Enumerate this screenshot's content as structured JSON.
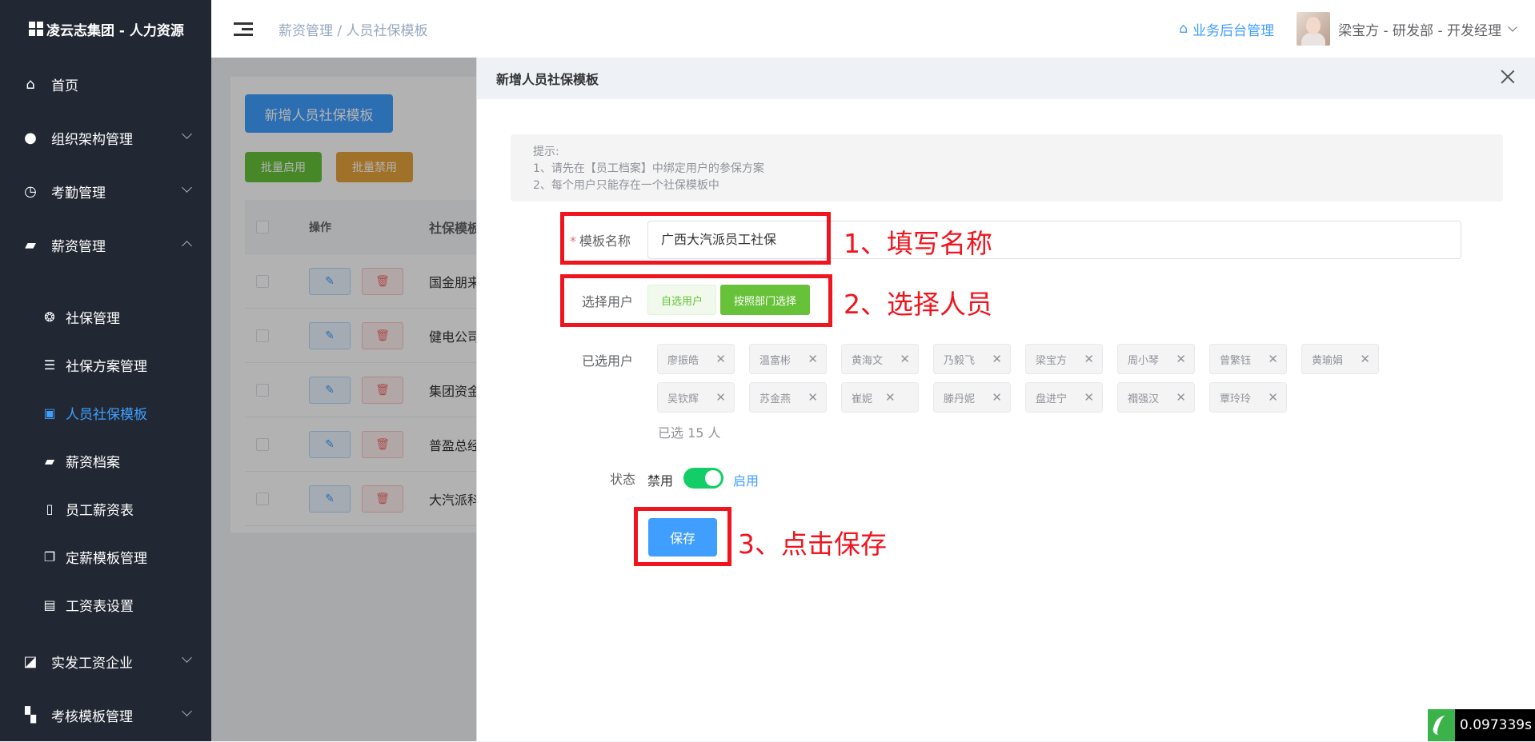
{
  "sidebar": {
    "logo_text": "凌云志集团 - 人力资源",
    "menu": [
      {
        "label": "首页",
        "icon": "home-icon"
      },
      {
        "label": "组织架构管理",
        "icon": "user-icon"
      },
      {
        "label": "考勤管理",
        "icon": "clock-icon"
      },
      {
        "label": "薪资管理",
        "icon": "wallet-icon"
      }
    ],
    "sub_items": [
      {
        "label": "社保管理",
        "icon": "shield-icon"
      },
      {
        "label": "社保方案管理",
        "icon": "sliders-icon"
      },
      {
        "label": "人员社保模板",
        "icon": "briefcase-icon"
      },
      {
        "label": "薪资档案",
        "icon": "wallet-icon"
      },
      {
        "label": "员工薪资表",
        "icon": "book-icon"
      },
      {
        "label": "定薪模板管理",
        "icon": "copy-icon"
      },
      {
        "label": "工资表设置",
        "icon": "list-icon"
      }
    ],
    "bottom_menu": [
      {
        "label": "实发工资企业",
        "icon": "chart-icon"
      },
      {
        "label": "考核模板管理",
        "icon": "bookmarks-icon"
      }
    ]
  },
  "header": {
    "breadcrumb_parent": "薪资管理",
    "breadcrumb_sep": "/",
    "breadcrumb_current": "人员社保模板",
    "backend_link": "业务后台管理",
    "user": "梁宝方 - 研发部 - 开发经理"
  },
  "page": {
    "add_button": "新增人员社保模板",
    "batch_enable": "批量启用",
    "batch_disable": "批量禁用",
    "table_headers": {
      "op": "操作",
      "name": "社保模板"
    },
    "rows": [
      "国金朋来",
      "健电公司",
      "集团资金",
      "普盈总经",
      "大汽派科"
    ],
    "edit_glyph": "✎",
    "delete_glyph": "🗑"
  },
  "drawer": {
    "title": "新增人员社保模板",
    "tip_title": "提示:",
    "tip_line1": "1、请先在【员工档案】中绑定用户的参保方案",
    "tip_line2": "2、每个用户只能存在一个社保模板中",
    "name_label": "模板名称",
    "name_required_mark": "*",
    "name_value": "广西大汽派员工社保",
    "select_user_label": "选择用户",
    "btn_self_select": "自选用户",
    "btn_dept_select": "按照部门选择",
    "selected_label": "已选用户",
    "selected_users": [
      "廖振皓",
      "温富彬",
      "黄海文",
      "乃毅飞",
      "梁宝方",
      "周小琴",
      "曾繁钰",
      "黄瑜娟",
      "吴钦辉",
      "苏金燕",
      "崔妮",
      "滕丹妮",
      "盘进宁",
      "禤强汉",
      "覃玲玲"
    ],
    "tag_close": "✕",
    "selected_count": "已选 15 人",
    "status_label": "状态",
    "status_off": "禁用",
    "status_on": "启用",
    "status_enabled": true,
    "save": "保存"
  },
  "annotations": {
    "step1": "1、填写名称",
    "step2": "2、选择人员",
    "step3": "3、点击保存",
    "color": "#f0141e"
  },
  "timer": "0.097339s",
  "colors": {
    "primary": "#409eff",
    "success": "#67c23a",
    "warning": "#e6a23c",
    "switch_on": "#13ce66",
    "sidebar_bg": "#222833"
  }
}
